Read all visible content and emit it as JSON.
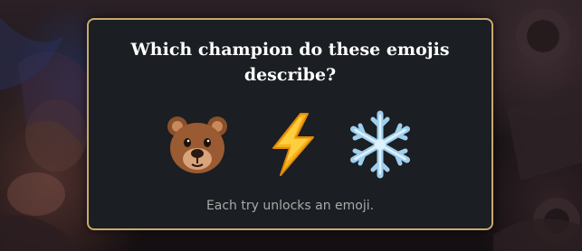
{
  "dialog": {
    "question": "Which champion do these emojis describe?",
    "hint": "Each try unlocks an emoji."
  },
  "emojis": [
    {
      "icon": "bear-face-icon",
      "label": "🐻"
    },
    {
      "icon": "lightning-bolt-icon",
      "label": "⚡"
    },
    {
      "icon": "snowflake-icon",
      "label": "❄"
    }
  ],
  "colors": {
    "card_background": "#1b1e22",
    "card_border": "#c8aa6e",
    "question_text": "#ffffff",
    "hint_text": "#a9a9a9"
  }
}
